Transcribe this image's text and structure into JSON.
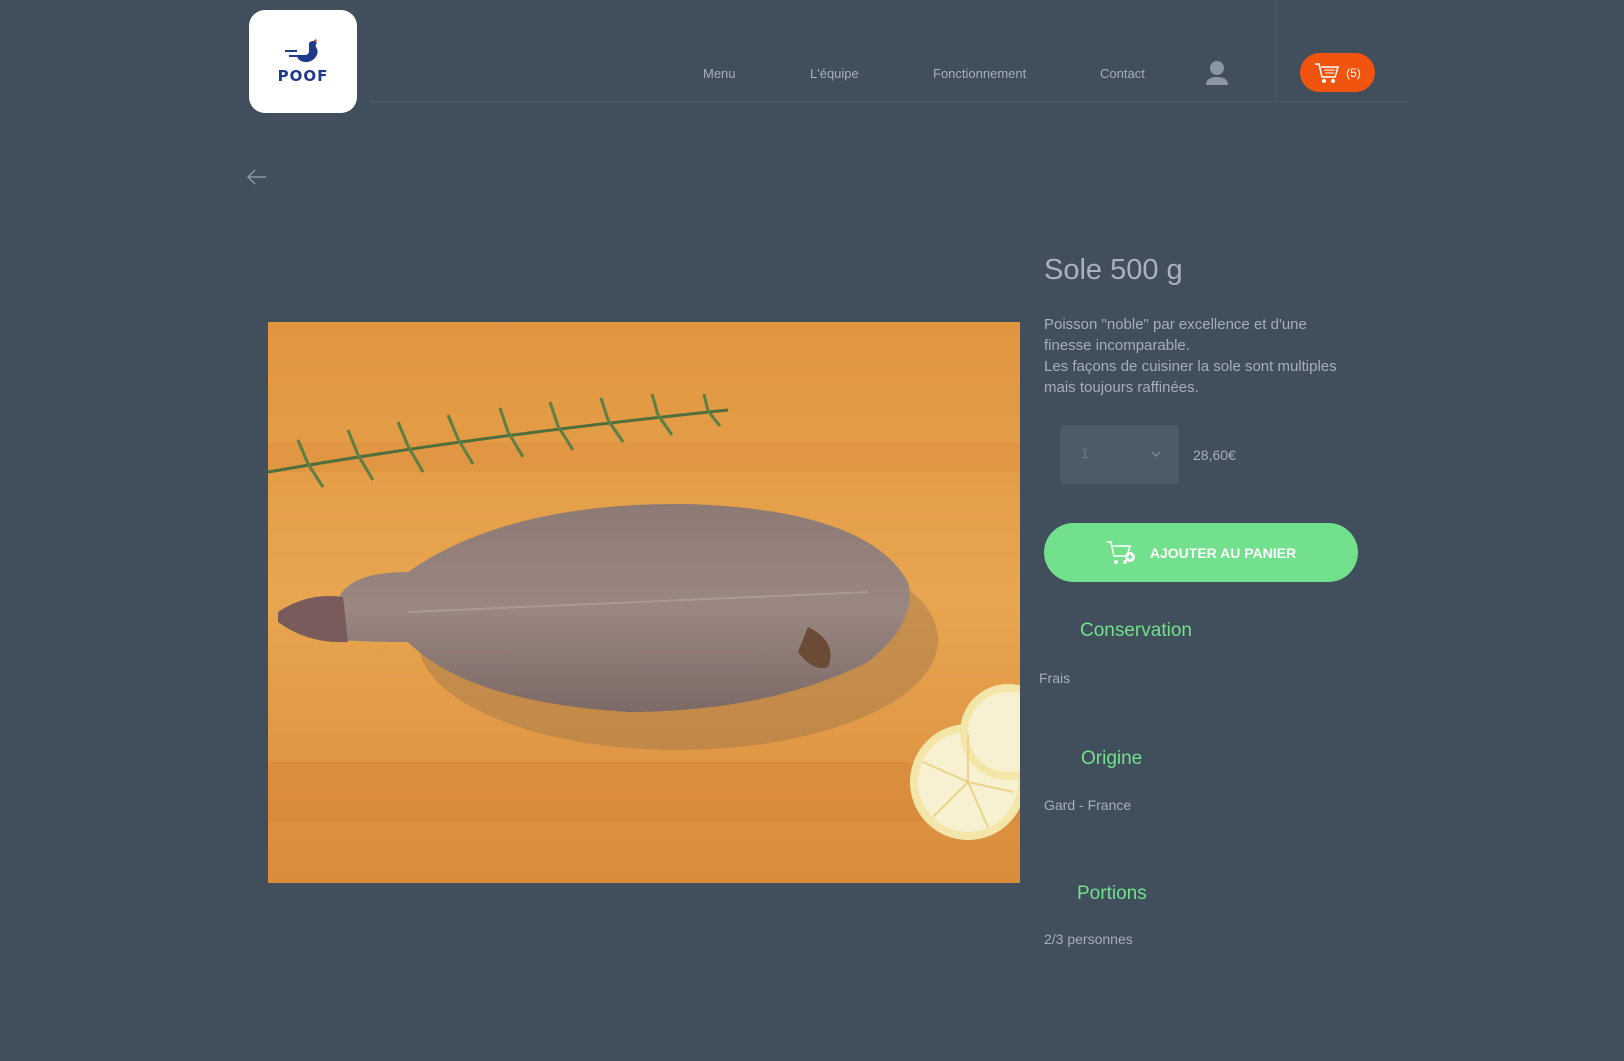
{
  "brand": {
    "logo_text": "POOF",
    "logo_icon": "rooster-icon"
  },
  "nav": {
    "items": [
      {
        "label": "Menu"
      },
      {
        "label": "L'équipe"
      },
      {
        "label": "Fonctionnement"
      },
      {
        "label": "Contact"
      }
    ],
    "user_icon": "user-icon"
  },
  "cart": {
    "count_label": "(5)",
    "icon": "cart-icon",
    "color": "#f0540f"
  },
  "back": {
    "icon": "arrow-left-icon"
  },
  "product": {
    "title": "Sole 500 g",
    "description": [
      "Poisson \"noble\" par excellence et d'une finesse incomparable.",
      "Les façons de cuisiner la sole sont multiples mais toujours raffinées."
    ],
    "quantity": "1",
    "price": "28,60€",
    "add_to_cart_label": "AJOUTER AU PANIER",
    "add_to_cart_color": "#72e08d",
    "details": [
      {
        "title": "Conservation",
        "value": "Frais"
      },
      {
        "title": "Origine",
        "value": "Gard - France"
      },
      {
        "title": "Portions",
        "value": "2/3 personnes"
      }
    ]
  },
  "colors": {
    "background": "#404f5b",
    "accent_green": "#72e08d",
    "accent_orange": "#f0540f"
  }
}
